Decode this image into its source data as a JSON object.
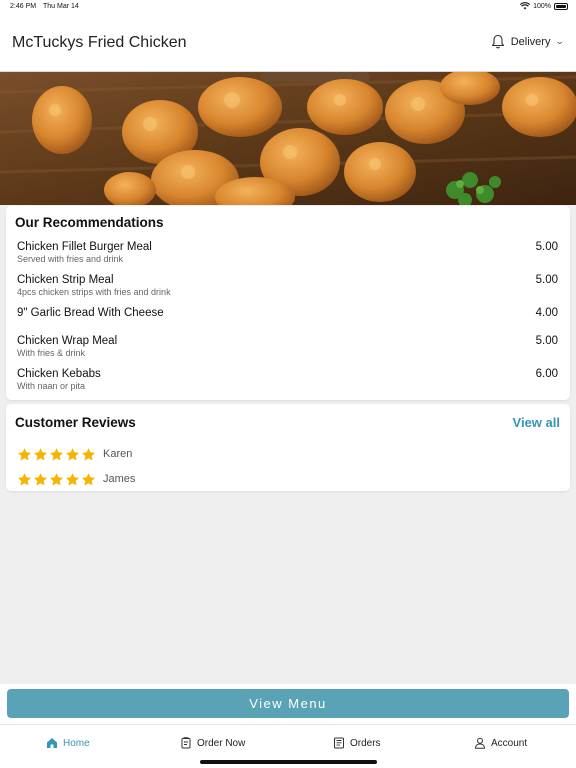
{
  "status_bar": {
    "time": "2:46 PM",
    "date": "Thu Mar 14",
    "battery": "100%"
  },
  "header": {
    "title": "McTuckys Fried Chicken",
    "delivery_label": "Delivery"
  },
  "recommendations": {
    "title": "Our Recommendations",
    "items": [
      {
        "name": "Chicken Fillet Burger Meal",
        "description": "Served with fries and drink",
        "price": "5.00"
      },
      {
        "name": "Chicken Strip Meal",
        "description": "4pcs chicken strips with fries and drink",
        "price": "5.00"
      },
      {
        "name": "9\" Garlic Bread With Cheese",
        "description": "",
        "price": "4.00"
      },
      {
        "name": "Chicken Wrap Meal",
        "description": "With fries & drink",
        "price": "5.00"
      },
      {
        "name": "Chicken Kebabs",
        "description": "With naan or pita",
        "price": "6.00"
      }
    ]
  },
  "reviews": {
    "title": "Customer Reviews",
    "view_all_label": "View all",
    "items": [
      {
        "reviewer": "Karen",
        "rating": 5
      },
      {
        "reviewer": "James",
        "rating": 5
      }
    ]
  },
  "view_menu_label": "View Menu",
  "tabs": [
    {
      "label": "Home",
      "icon": "home-icon",
      "active": true
    },
    {
      "label": "Order Now",
      "icon": "order-icon",
      "active": false
    },
    {
      "label": "Orders",
      "icon": "receipt-icon",
      "active": false
    },
    {
      "label": "Account",
      "icon": "person-icon",
      "active": false
    }
  ],
  "colors": {
    "accent": "#3496b4",
    "button": "#5aa3b7",
    "star": "#f5b400"
  }
}
